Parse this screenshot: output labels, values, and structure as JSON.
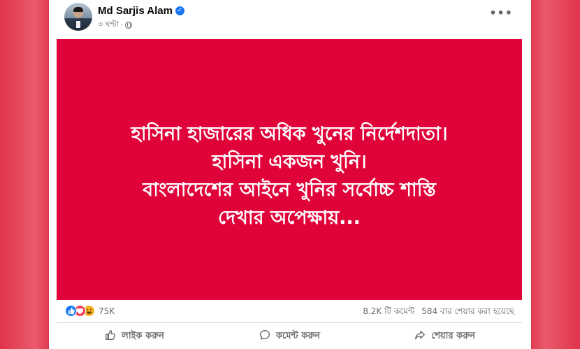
{
  "post": {
    "author": "Md Sarjis Alam",
    "verified": true,
    "time": "৩ ঘণ্টা",
    "privacy_icon": "globe-icon",
    "more_icon": "more-options-icon",
    "image": {
      "background_color": "#e0033a",
      "text_color": "#ffffff",
      "lines": [
        "হাসিনা হাজারের অধিক খুনের নির্দেশদাতা।",
        "হাসিনা একজন খুনি।",
        "বাংলাদেশের আইনে খুনির সর্বোচ্চ শাস্তি",
        "দেখার অপেক্ষায়..."
      ]
    },
    "stats": {
      "reactions": [
        "like",
        "love",
        "haha"
      ],
      "reaction_count": "75K",
      "comments": "8.2K টি কমেন্ট",
      "shares": "584 বার শেয়ার করা হয়েছে"
    },
    "actions": {
      "like_label": "লাইক করুন",
      "comment_label": "কমেন্ট করুন",
      "share_label": "শেয়ার করুন"
    }
  },
  "colors": {
    "page_background": "#e0344c",
    "accent": "#1877f2",
    "secondary_text": "#65676b"
  }
}
